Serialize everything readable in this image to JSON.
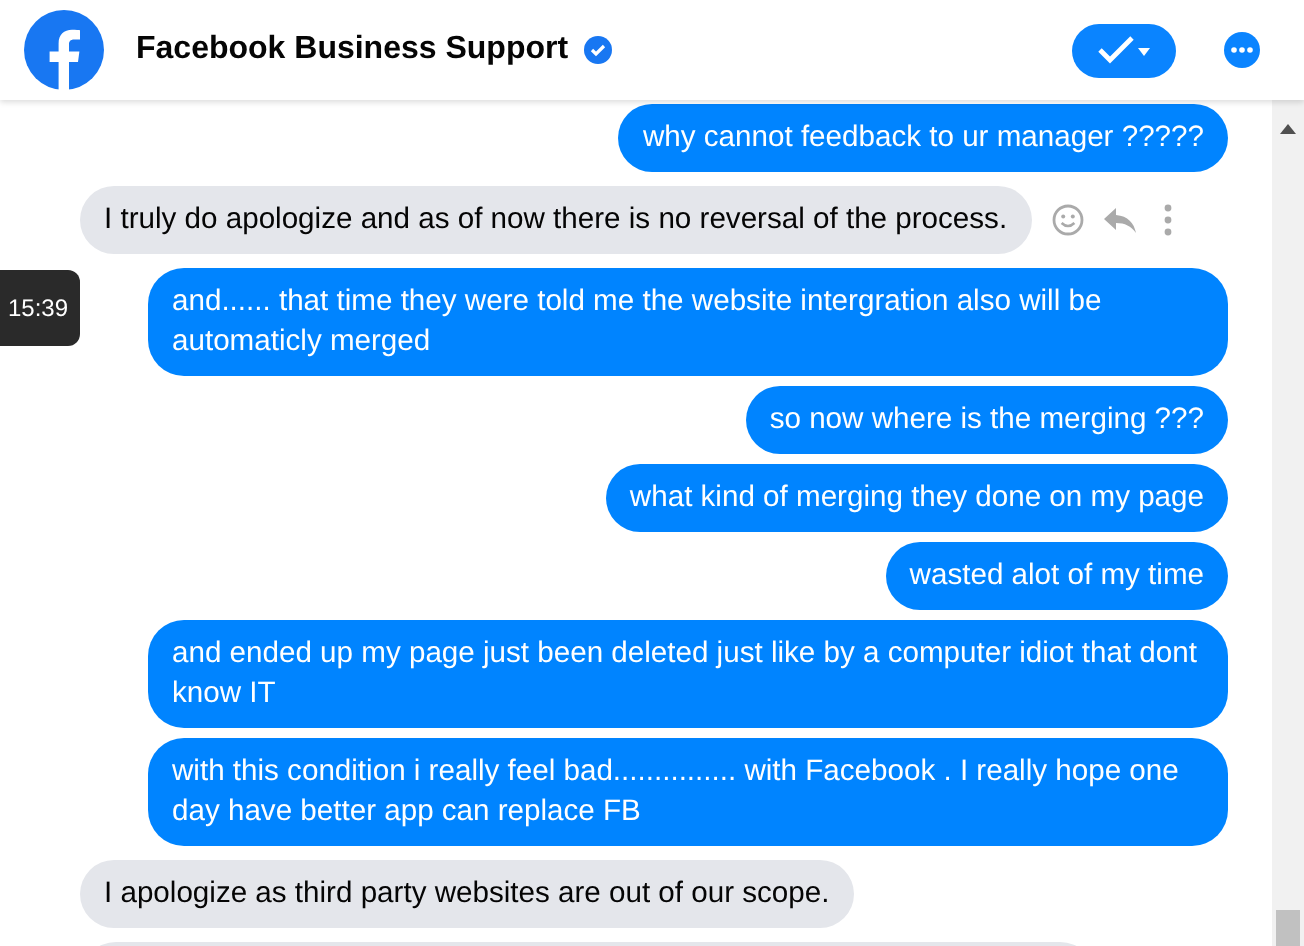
{
  "header": {
    "title": "Facebook Business Support",
    "verified": true
  },
  "tooltip": {
    "time": "15:39"
  },
  "messages": [
    {
      "kind": "sent",
      "text": "why cannot feedback to ur manager ?????"
    },
    {
      "kind": "received",
      "text": "I truly do apologize and as of now there is no reversal of the process.",
      "actions": true
    },
    {
      "kind": "sent",
      "text": "and...... that time they were told me the website intergration also will be automaticly merged"
    },
    {
      "kind": "sent",
      "text": "so now where is the merging ???"
    },
    {
      "kind": "sent",
      "text": "what kind of merging they done on my page"
    },
    {
      "kind": "sent",
      "text": "wasted alot of my time"
    },
    {
      "kind": "sent",
      "text": "and ended up my page just been deleted just like by a computer idiot that dont know IT"
    },
    {
      "kind": "sent",
      "text": "with this condition i really feel bad............... with Facebook . I really hope one day have better app can replace FB"
    },
    {
      "kind": "received",
      "text": "I apologize as third party websites are out of our scope."
    },
    {
      "kind": "received",
      "partial": true
    }
  ]
}
